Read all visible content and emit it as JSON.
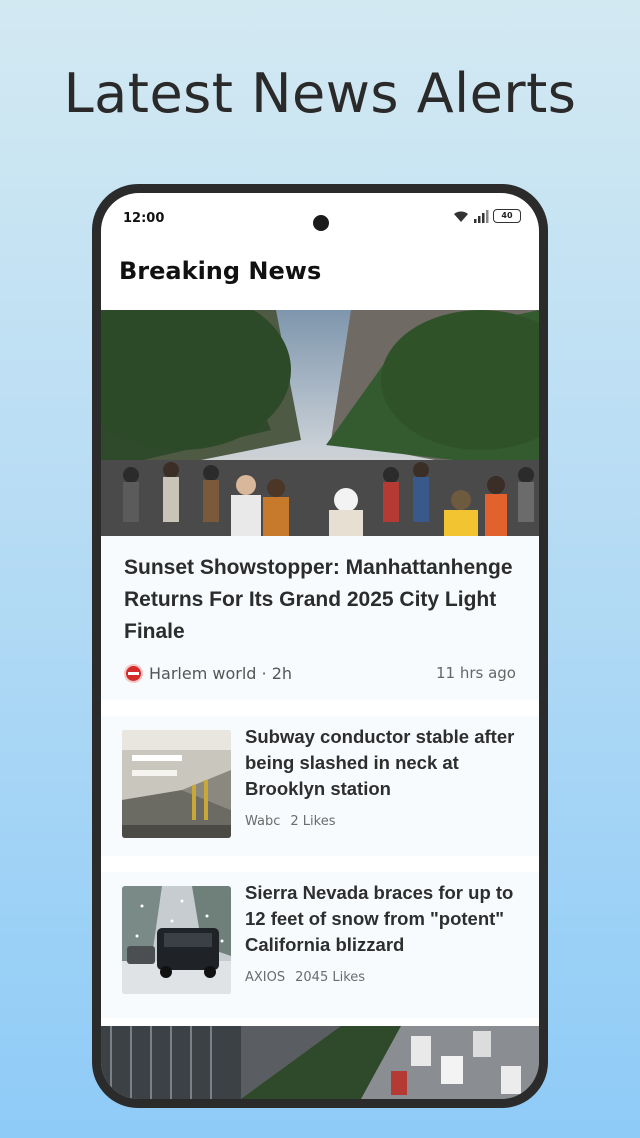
{
  "promo": {
    "title": "Latest News Alerts"
  },
  "status_bar": {
    "time": "12:00",
    "battery": "40"
  },
  "app": {
    "header_title": "Breaking News"
  },
  "hero": {
    "title": "Sunset Showstopper: Manhattanhenge Returns For Its Grand 2025 City Light Finale",
    "source": "Harlem world · 2h",
    "time_ago": "11 hrs ago"
  },
  "articles": [
    {
      "title": "Subway conductor stable after being slashed in neck at Brooklyn station",
      "source": "Wabc",
      "likes": "2 Likes"
    },
    {
      "title": "Sierra Nevada braces for up to 12 feet of snow from \"potent\" California blizzard",
      "source": "AXIOS",
      "likes": "2045 Likes"
    }
  ],
  "colors": {
    "background_top": "#d3e9f2",
    "background_bottom": "#8ecbf7",
    "phone_frame": "#2b2b2b",
    "card_bg": "#f7fbfd",
    "source_logo": "#d62b2b"
  },
  "icons": [
    "wifi-icon",
    "signal-icon",
    "battery-icon",
    "source-logo-icon"
  ]
}
